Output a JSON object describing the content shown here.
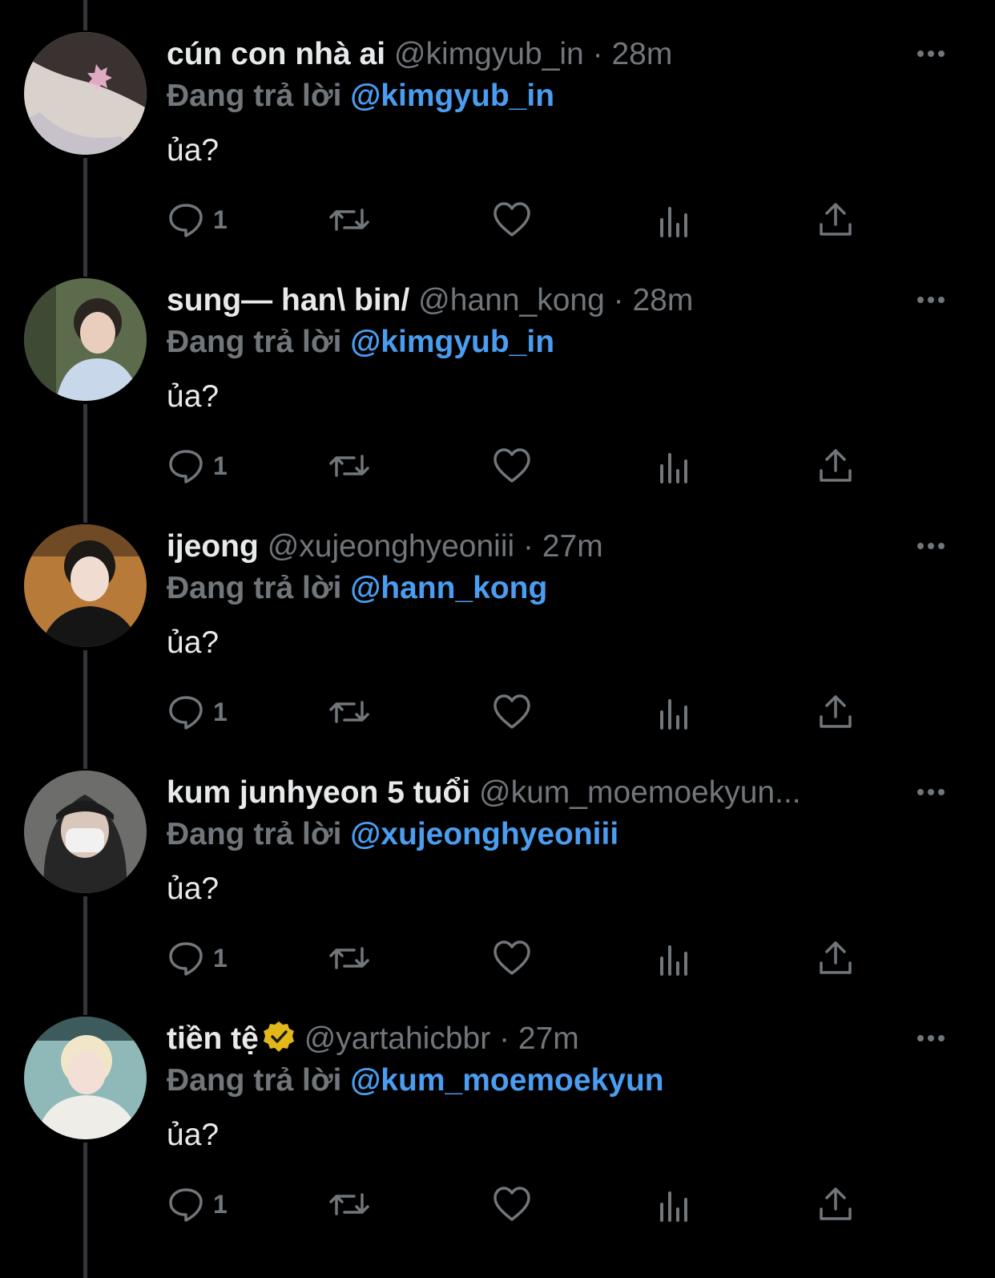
{
  "colors": {
    "background": "#000000",
    "text_primary": "#e7e9ea",
    "text_secondary": "#71767b",
    "link": "#4a9df0",
    "thread_line": "#333639",
    "verified_gold": "#e2b719"
  },
  "icons": {
    "reply": "speech-bubble-icon",
    "retweet": "retweet-icon",
    "like": "heart-icon",
    "views": "bar-chart-icon",
    "share": "share-upload-icon",
    "more": "ellipsis-icon",
    "verified": "verified-badge-icon"
  },
  "tweets": [
    {
      "display_name": "cún con nhà ai",
      "handle": "@kimgyub_in",
      "separator": "·",
      "time": "28m",
      "reply_prefix": "Đang trả lời",
      "reply_mention": "@kimgyub_in",
      "text": "ủa?",
      "reply_count": "1",
      "verified": false
    },
    {
      "display_name": "sung— han\\ bin/",
      "handle": "@hann_kong",
      "separator": "·",
      "time": "28m",
      "reply_prefix": "Đang trả lời",
      "reply_mention": "@kimgyub_in",
      "text": "ủa?",
      "reply_count": "1",
      "verified": false
    },
    {
      "display_name": "ijeong",
      "handle": "@xujeonghyeoniii",
      "separator": "·",
      "time": "27m",
      "reply_prefix": "Đang trả lời",
      "reply_mention": "@hann_kong",
      "text": "ủa?",
      "reply_count": "1",
      "verified": false
    },
    {
      "display_name": "kum junhyeon 5 tuổi",
      "handle": "@kum_moemoekyun...",
      "separator": "",
      "time": "",
      "reply_prefix": "Đang trả lời",
      "reply_mention": "@xujeonghyeoniii",
      "text": "ủa?",
      "reply_count": "1",
      "verified": false
    },
    {
      "display_name": "tiền tệ",
      "handle": "@yartahicbbr",
      "separator": "·",
      "time": "27m",
      "reply_prefix": "Đang trả lời",
      "reply_mention": "@kum_moemoekyun",
      "text": "ủa?",
      "reply_count": "1",
      "verified": true
    }
  ]
}
